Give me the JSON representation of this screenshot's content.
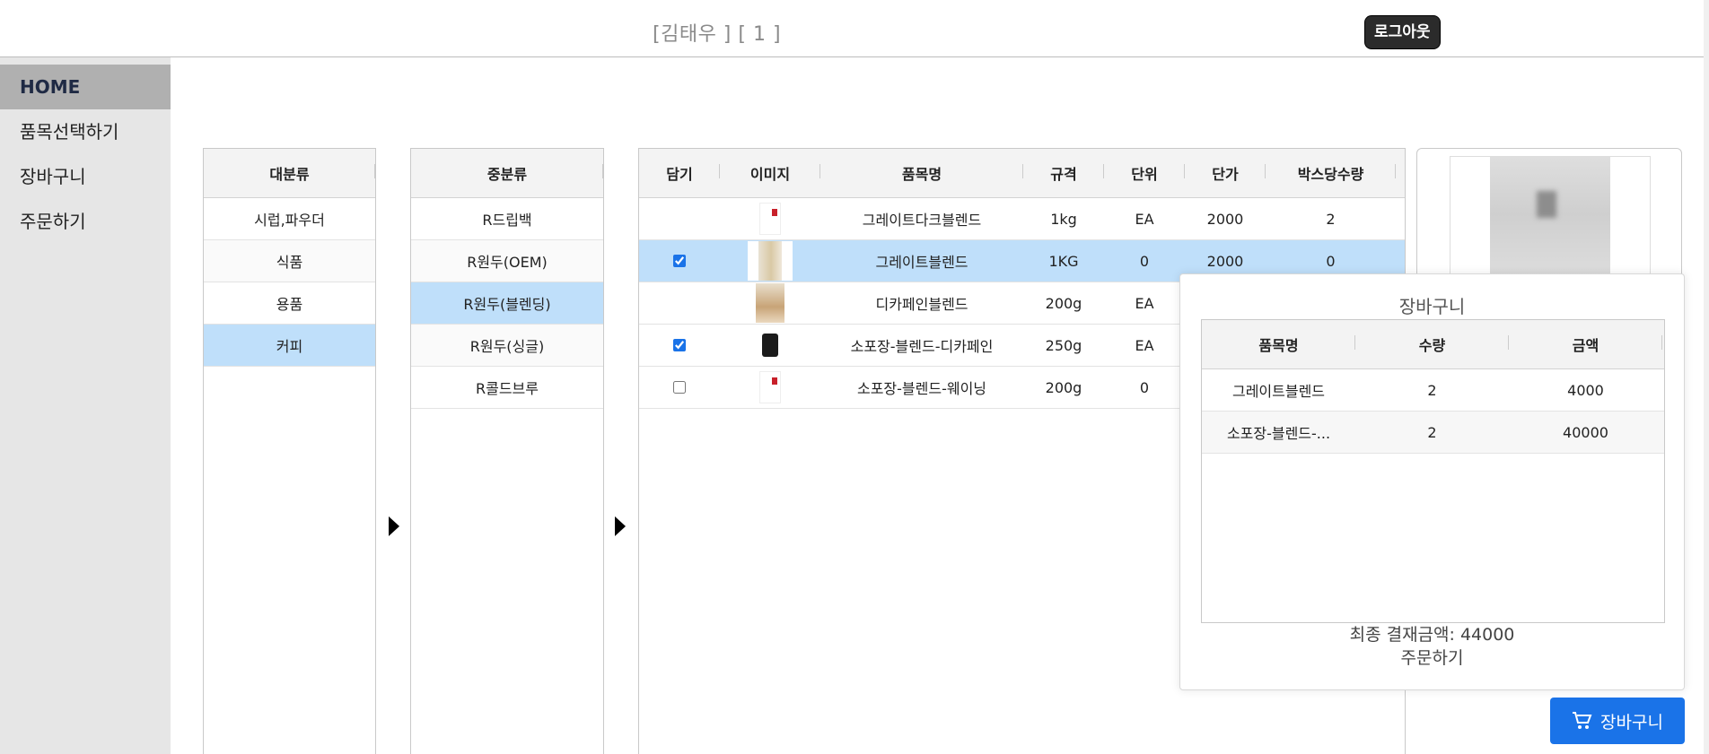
{
  "header": {
    "user_info": "[김태우 ] [ 1 ]",
    "logout_label": "로그아웃"
  },
  "sidebar": {
    "items": [
      {
        "label": "HOME",
        "active": true
      },
      {
        "label": "품목선택하기"
      },
      {
        "label": "장바구니"
      },
      {
        "label": "주문하기"
      }
    ]
  },
  "major_category": {
    "header": "대분류",
    "items": [
      "시럽,파우더",
      "식품",
      "용품",
      "커피"
    ],
    "selected": "커피"
  },
  "minor_category": {
    "header": "중분류",
    "items": [
      "R드립백",
      "R원두(OEM)",
      "R원두(블렌딩)",
      "R원두(싱글)",
      "R콜드브루"
    ],
    "selected": "R원두(블렌딩)"
  },
  "products": {
    "headers": {
      "check": "담기",
      "image": "이미지",
      "name": "품목명",
      "spec": "규격",
      "unit": "단위",
      "price": "단가",
      "per_box": "박스당수량"
    },
    "rows": [
      {
        "checked": null,
        "image": "red-label-pack",
        "name": "그레이트다크블렌드",
        "spec": "1kg",
        "unit": "EA",
        "price": "2000",
        "per_box": "2"
      },
      {
        "checked": true,
        "image": "kraft-bag",
        "name": "그레이트블렌드",
        "spec": "1KG",
        "unit": "0",
        "price": "2000",
        "per_box": "0"
      },
      {
        "checked": null,
        "image": "kraft-bag-small",
        "name": "디카페인블렌드",
        "spec": "200g",
        "unit": "EA",
        "price": "",
        "per_box": ""
      },
      {
        "checked": true,
        "image": "black-bag",
        "name": "소포장-블렌드-디카페인",
        "spec": "250g",
        "unit": "EA",
        "price": "",
        "per_box": ""
      },
      {
        "checked": false,
        "image": "red-label-pack",
        "name": "소포장-블렌드-웨이닝",
        "spec": "200g",
        "unit": "0",
        "price": "",
        "per_box": ""
      }
    ]
  },
  "preview": {
    "image": "coffee-bag-photo"
  },
  "cart_popup": {
    "title": "장바구니",
    "headers": {
      "name": "품목명",
      "qty": "수량",
      "amount": "금액"
    },
    "rows": [
      {
        "name": "그레이트블렌드",
        "qty": "2",
        "amount": "4000"
      },
      {
        "name": "소포장-블렌드-...",
        "qty": "2",
        "amount": "40000"
      }
    ],
    "total": "최종 결재금액: 44000",
    "order_label": "주문하기"
  },
  "cart_button": {
    "label": "장바구니",
    "icon": "cart-icon"
  },
  "colors": {
    "selected_row": "#bfdffa",
    "accent": "#1a73e8",
    "sidebar_bg": "#e6e6e6",
    "sidebar_active": "#b0b0b0"
  }
}
